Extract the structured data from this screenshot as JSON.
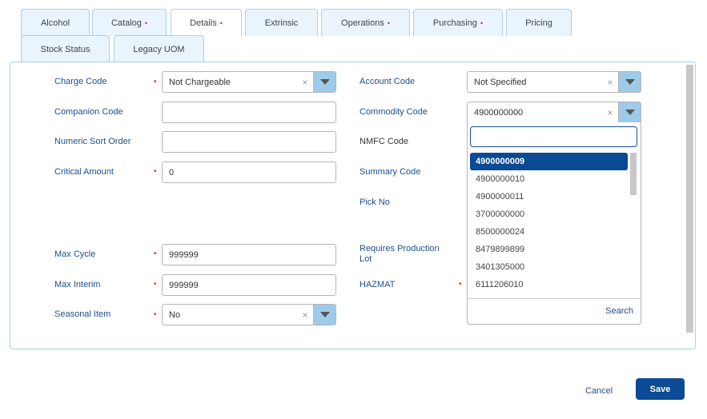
{
  "tabs": [
    {
      "label": "Alcohol",
      "required": false,
      "active": false
    },
    {
      "label": "Catalog",
      "required": true,
      "active": false
    },
    {
      "label": "Details",
      "required": true,
      "active": true
    },
    {
      "label": "Extrinsic",
      "required": false,
      "active": false
    },
    {
      "label": "Operations",
      "required": true,
      "active": false
    },
    {
      "label": "Purchasing",
      "required": true,
      "active": false
    },
    {
      "label": "Pricing",
      "required": false,
      "active": false
    },
    {
      "label": "Stock Status",
      "required": false,
      "active": false
    },
    {
      "label": "Legacy UOM",
      "required": false,
      "active": false
    }
  ],
  "required_marker": "•",
  "left_fields": {
    "charge_code": {
      "label": "Charge Code",
      "value": "Not Chargeable"
    },
    "companion_code": {
      "label": "Companion Code",
      "value": ""
    },
    "numeric_sort_order": {
      "label": "Numeric Sort Order",
      "value": ""
    },
    "critical_amount": {
      "label": "Critical Amount",
      "value": "0"
    },
    "max_cycle": {
      "label": "Max Cycle",
      "value": "999999"
    },
    "max_interim": {
      "label": "Max Interim",
      "value": "999999"
    },
    "seasonal_item": {
      "label": "Seasonal Item",
      "value": "No"
    }
  },
  "right_fields": {
    "account_code": {
      "label": "Account Code",
      "value": "Not Specified"
    },
    "commodity_code": {
      "label": "Commodity Code",
      "value": "4900000000"
    },
    "nmfc_code": {
      "label": "NMFC Code"
    },
    "summary_code": {
      "label": "Summary Code"
    },
    "pick_no": {
      "label": "Pick No"
    },
    "requires_production_lot": {
      "label": "Requires Production Lot"
    },
    "hazmat": {
      "label": "HAZMAT"
    }
  },
  "commodity_dropdown": {
    "search_value": "",
    "options": [
      "4900000009",
      "4900000010",
      "4900000011",
      "3700000000",
      "8500000024",
      "8479899899",
      "3401305000",
      "6111206010"
    ],
    "selected_index": 0,
    "footer_link": "Search"
  },
  "icons": {
    "clear": "×"
  },
  "actions": {
    "cancel": "Cancel",
    "save": "Save"
  },
  "colors": {
    "accent": "#0b4a94",
    "label": "#1c4f8f",
    "required": "#e0262b",
    "tab_bg": "#e9f4fd"
  }
}
